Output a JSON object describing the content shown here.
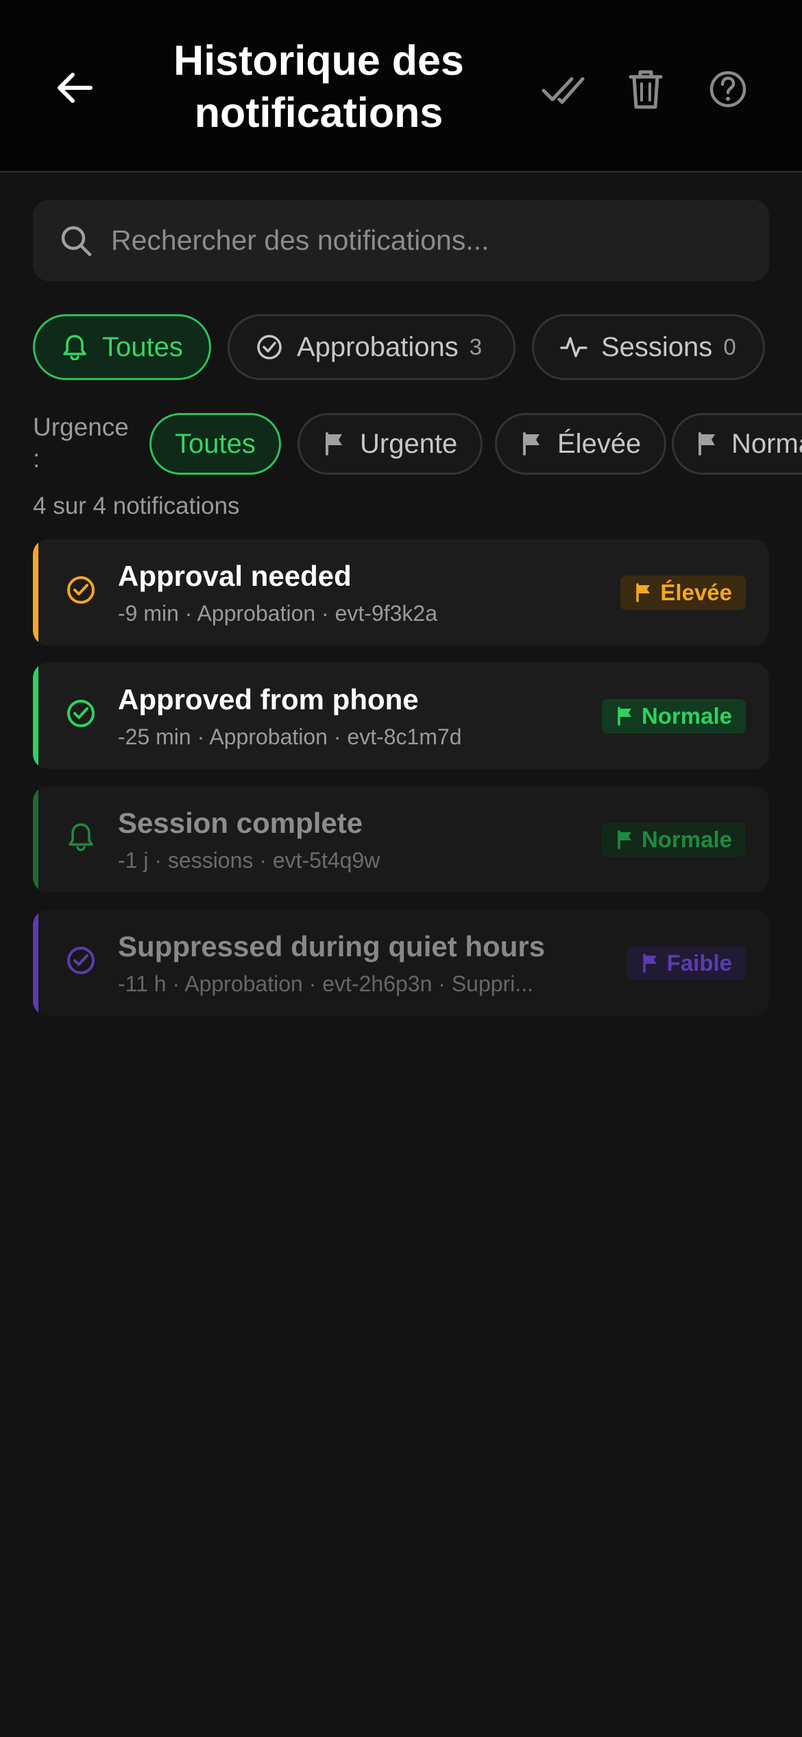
{
  "header": {
    "title": "Historique des notifications",
    "icons": [
      "back-arrow-icon",
      "double-check-icon",
      "trash-icon",
      "help-icon"
    ]
  },
  "search": {
    "placeholder": "Rechercher des notifications..."
  },
  "type_filters": [
    {
      "label": "Toutes",
      "count": "",
      "icon": "bell-icon",
      "active": true
    },
    {
      "label": "Approbations",
      "count": "3",
      "icon": "check-circle-icon",
      "active": false
    },
    {
      "label": "Sessions",
      "count": "0",
      "icon": "activity-icon",
      "active": false
    }
  ],
  "urgency": {
    "label": "Urgence :",
    "chips": [
      {
        "label": "Toutes",
        "active": true
      },
      {
        "label": "Urgente",
        "icon": "flag-icon"
      },
      {
        "label": "Élevée",
        "icon": "flag-icon"
      },
      {
        "label": "Normale",
        "icon": "flag-icon"
      }
    ]
  },
  "count_text": "4 sur 4 notifications",
  "notifications": [
    {
      "title": "Approval needed",
      "meta": "-9 min · Approbation · evt-9f3k2a",
      "badge": "Élevée",
      "accent": "#f5a623",
      "icon": "check-circle-icon"
    },
    {
      "title": "Approved from phone",
      "meta": "-25 min · Approbation · evt-8c1m7d",
      "badge": "Normale",
      "accent": "#2fd15f",
      "icon": "check-circle-icon"
    },
    {
      "title": "Session complete",
      "meta": "-1 j · sessions · evt-5t4q9w",
      "badge": "Normale",
      "accent": "#1f6b33",
      "icon": "bell-icon"
    },
    {
      "title": "Suppressed during quiet hours",
      "meta": "-11 h · Approbation · evt-2h6p3n · Suppri...",
      "badge": "Faible",
      "accent": "#5b3bb0",
      "icon": "check-circle-icon"
    }
  ],
  "colors": {
    "background": "#131313",
    "active_green": "#39d366",
    "elevated_orange": "#f5a623",
    "low_purple": "#5b3bb0"
  }
}
